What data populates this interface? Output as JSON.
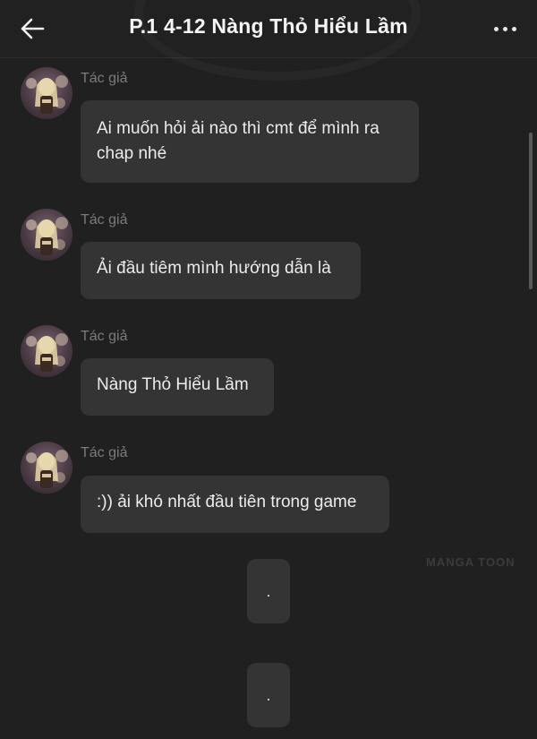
{
  "header": {
    "title": "P.1 4-12 Nàng Thỏ Hiểu Lầm",
    "back_icon": "arrow-left-icon",
    "more_icon": "more-horizontal-icon"
  },
  "messages": [
    {
      "sender": "Tác giả",
      "text_line1": "Ai muốn hỏi ải nào thì cmt để mình ra",
      "text_line2": "chap nhé"
    },
    {
      "sender": "Tác giả",
      "text": "Ải đầu tiêm mình hướng dẫn là"
    },
    {
      "sender": "Tác giả",
      "text": "Nàng Thỏ Hiểu Lầm"
    },
    {
      "sender": "Tác giả",
      "text": ":)) ải khó nhất đầu tiên trong game"
    }
  ],
  "dot_messages": [
    {
      "text": "."
    },
    {
      "text": "."
    }
  ],
  "watermark": "MANGA TOON",
  "colors": {
    "background": "#202020",
    "bubble": "#343434",
    "sender": "#7b7b7b",
    "text": "#ececec"
  }
}
